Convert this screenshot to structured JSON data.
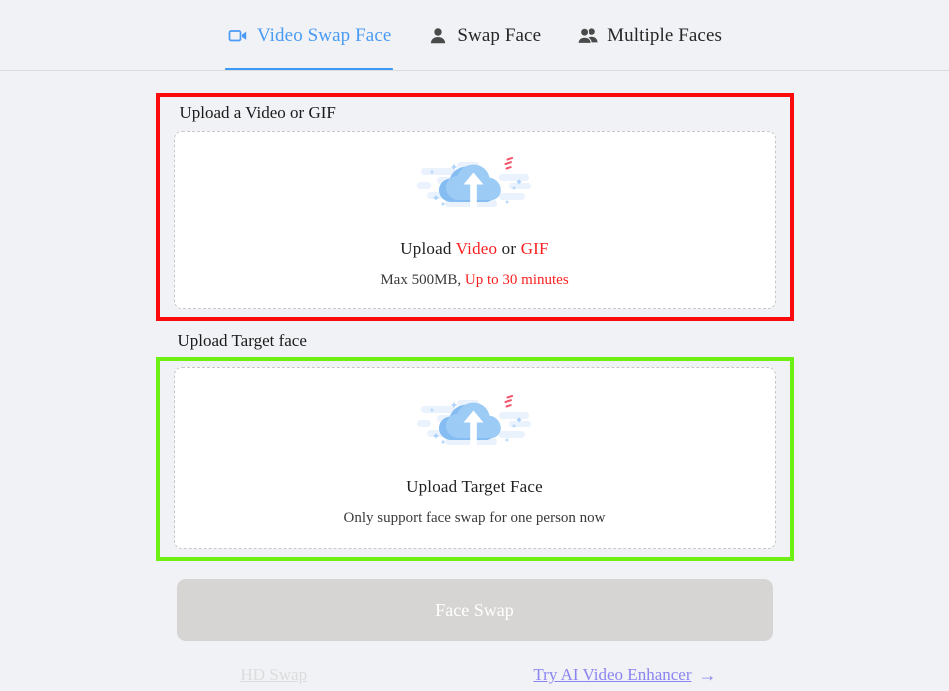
{
  "tabs": [
    {
      "label": "Video Swap Face",
      "icon": "video-camera-icon",
      "active": true
    },
    {
      "label": "Swap Face",
      "icon": "single-person-icon",
      "active": false
    },
    {
      "label": "Multiple Faces",
      "icon": "multiple-people-icon",
      "active": false
    }
  ],
  "video_section": {
    "title": "Upload a Video or GIF",
    "dropzone": {
      "icon": "cloud-upload-icon",
      "title_prefix": "Upload ",
      "title_accent1": "Video",
      "title_middle": " or ",
      "title_accent2": "GIF",
      "sub_prefix": "Max 500MB, ",
      "sub_accent": "Up to 30 minutes"
    },
    "highlight_color": "#fb0b0b"
  },
  "face_section": {
    "title": "Upload Target face",
    "dropzone": {
      "icon": "cloud-upload-icon",
      "title": "Upload Target Face",
      "sub": "Only support face swap for one person now"
    },
    "highlight_color": "#6ff014"
  },
  "footer": {
    "primary_button": "Face Swap",
    "primary_button_disabled": true,
    "hd_swap_label": "HD Swap",
    "enhancer_label": "Try AI Video Enhancer",
    "enhancer_arrow": "→",
    "enhancer_color": "#8b84f0"
  }
}
